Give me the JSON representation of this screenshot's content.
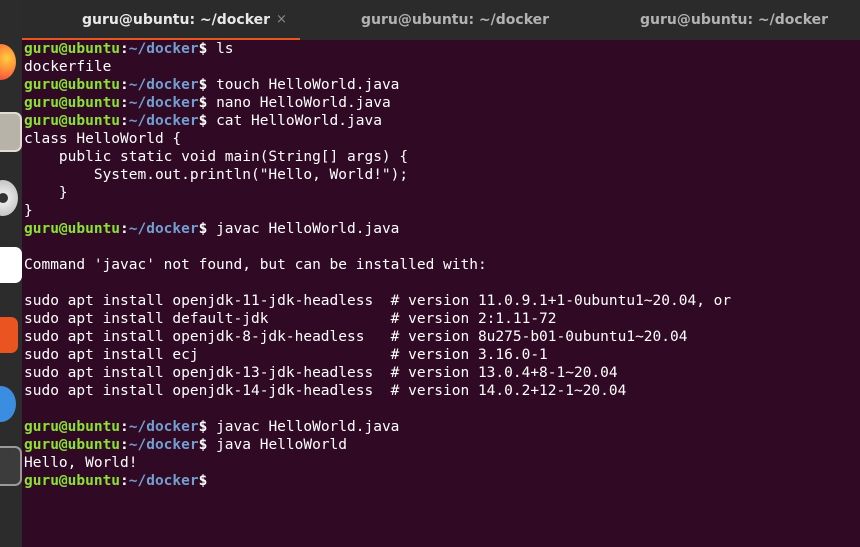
{
  "tabs": [
    {
      "title": "guru@ubuntu: ~/docker",
      "active": true
    },
    {
      "title": "guru@ubuntu: ~/docker",
      "active": false
    },
    {
      "title": "guru@ubuntu: ~/docker",
      "active": false
    }
  ],
  "tab_close_glyph": "×",
  "prompt": {
    "user_host": "guru@ubuntu",
    "separator": ":",
    "path": "~/docker",
    "symbol": "$"
  },
  "terminal_lines": [
    {
      "type": "prompt",
      "command": " ls"
    },
    {
      "type": "output",
      "text": "dockerfile"
    },
    {
      "type": "prompt",
      "command": " touch HelloWorld.java"
    },
    {
      "type": "prompt",
      "command": " nano HelloWorld.java"
    },
    {
      "type": "prompt",
      "command": " cat HelloWorld.java"
    },
    {
      "type": "output",
      "text": "class HelloWorld {"
    },
    {
      "type": "output",
      "text": "    public static void main(String[] args) {"
    },
    {
      "type": "output",
      "text": "        System.out.println(\"Hello, World!\");"
    },
    {
      "type": "output",
      "text": "    }"
    },
    {
      "type": "output",
      "text": "}"
    },
    {
      "type": "prompt",
      "command": " javac HelloWorld.java"
    },
    {
      "type": "output",
      "text": ""
    },
    {
      "type": "output",
      "text": "Command 'javac' not found, but can be installed with:"
    },
    {
      "type": "output",
      "text": ""
    },
    {
      "type": "output",
      "text": "sudo apt install openjdk-11-jdk-headless  # version 11.0.9.1+1-0ubuntu1~20.04, or"
    },
    {
      "type": "output",
      "text": "sudo apt install default-jdk              # version 2:1.11-72"
    },
    {
      "type": "output",
      "text": "sudo apt install openjdk-8-jdk-headless   # version 8u275-b01-0ubuntu1~20.04"
    },
    {
      "type": "output",
      "text": "sudo apt install ecj                      # version 3.16.0-1"
    },
    {
      "type": "output",
      "text": "sudo apt install openjdk-13-jdk-headless  # version 13.0.4+8-1~20.04"
    },
    {
      "type": "output",
      "text": "sudo apt install openjdk-14-jdk-headless  # version 14.0.2+12-1~20.04"
    },
    {
      "type": "output",
      "text": ""
    },
    {
      "type": "prompt",
      "command": " javac HelloWorld.java"
    },
    {
      "type": "prompt",
      "command": " java HelloWorld"
    },
    {
      "type": "output",
      "text": "Hello, World!"
    },
    {
      "type": "prompt",
      "command": ""
    }
  ],
  "colors": {
    "background": "#300a24",
    "prompt_user": "#8ae234",
    "prompt_path": "#729fcf",
    "tab_accent": "#e95420"
  }
}
